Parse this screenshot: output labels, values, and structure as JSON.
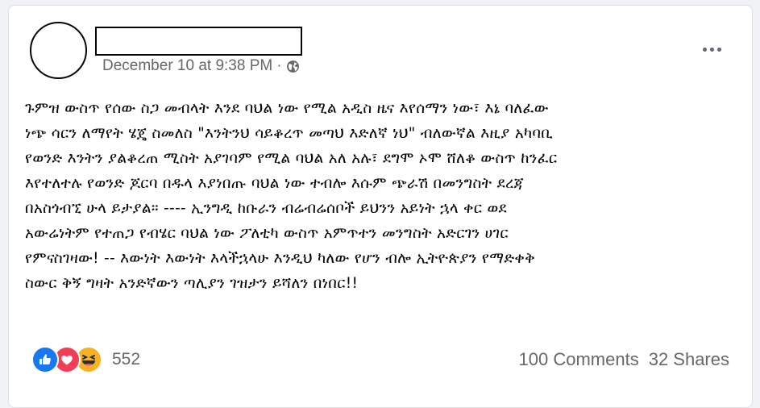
{
  "post": {
    "timestamp": "December 10 at 9:38 PM",
    "separator": "·",
    "privacy_icon": "globe-icon",
    "more_icon": "more-horizontal-icon",
    "text": "ጉምዝ ውስጥ የሰው ስጋ መብላት እንደ ባህል ነው የሚል አዲስ ዜና እየሰማን ነው፣ እኔ ባለፈው\nነጭ ሳርን ለማየት ሄጄ ስመለስ \"እንትንህ ሳይቆረጥ መጣህ እድለኛ ነህ\" ብለውኛል እዚያ አካባቢ\nየወንድ እንትን ያልቆረጠ ሚስት አያገባም የሚል ባህል አለ አሉ፣ ደግሞ ኦሞ ሸለቆ ውስጥ ከንፈር\nእየተለተሉ የወንድ ጆርባ በዱላ እያነበጡ ባህል ነው ተብሎ እሱም ጭራሽ በመንግስት ደረጃ\nበአስጎብኚ ሁላ ይታያል። ---- ኢንግዲ ከቡራን ብሬብሬሰቦች ይህንን አይነት ኋላ ቀር ወደ\nአውሬነትም የተጠጋ የብሄር ባህል ነው ፖለቲካ ውስጥ አምጥተን መንግስት አድርገን ሀገር\nየምናስገዛው! -- እውነት እውነት እላችኋላሁ እንዲህ ካለው የሆን ብሎ ኢትዮጵያን የማድቀቅ\nስውር ቅኝ ግዛት አንድኛውን ጣሊያን ገዝታን ይሻለን በነበር!!"
  },
  "reactions": {
    "icons": [
      "like-icon",
      "love-icon",
      "haha-icon"
    ],
    "count": "552"
  },
  "stats": {
    "comments": "100 Comments",
    "shares": "32 Shares"
  },
  "colors": {
    "like": "#1877f2",
    "love": "#f33e58",
    "haha": "#f7b125",
    "muted_text": "#65676b"
  }
}
